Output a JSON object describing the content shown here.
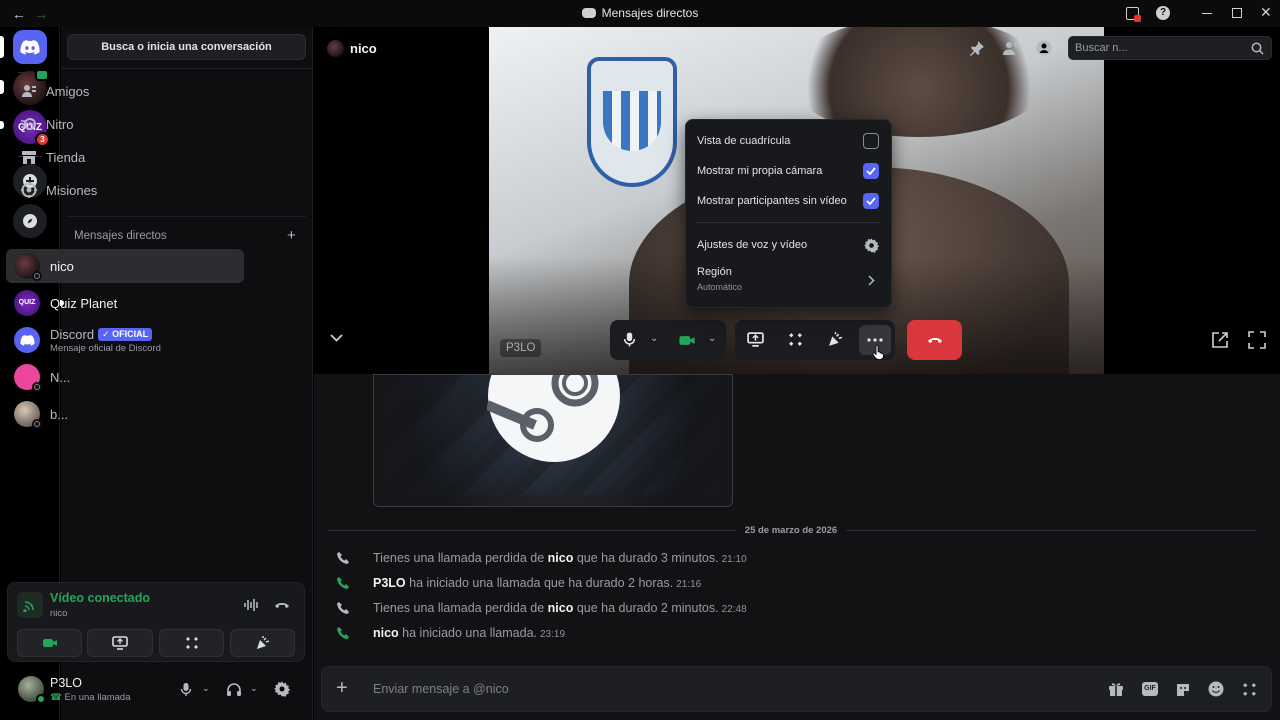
{
  "window": {
    "title": "Mensajes directos"
  },
  "sidebar": {
    "search_button": "Busca o inicia una conversación",
    "nav": [
      {
        "label": "Amigos",
        "icon": "friends-icon"
      },
      {
        "label": "Nitro",
        "icon": "nitro-icon"
      },
      {
        "label": "Tienda",
        "icon": "shop-icon"
      },
      {
        "label": "Misiones",
        "icon": "quests-icon"
      }
    ],
    "dm_header": "Mensajes directos",
    "dms": [
      {
        "name": "nico",
        "sub": ""
      },
      {
        "name": "Quiz Planet",
        "sub": ""
      },
      {
        "name": "Discord",
        "badge": "OFICIAL",
        "sub": "Mensaje oficial de Discord"
      },
      {
        "name": "N...",
        "sub": ""
      },
      {
        "name": "b...",
        "sub": ""
      }
    ]
  },
  "servers": {
    "quiz_badge": "3",
    "quiz_label": "QUIZ"
  },
  "voice_panel": {
    "status": "Vídeo conectado",
    "channel": "nico"
  },
  "user_panel": {
    "name": "P3LO",
    "status": "En una llamada"
  },
  "call": {
    "header_name": "nico",
    "search_placeholder": "Buscar n...",
    "self_label": "P3LO"
  },
  "menu": {
    "grid_view": "Vista de cuadrícula",
    "grid_view_checked": false,
    "show_camera": "Mostrar mi propia cámara",
    "show_camera_checked": true,
    "show_no_video": "Mostrar participantes sin vídeo",
    "show_no_video_checked": true,
    "voice_settings": "Ajustes de voz y vídeo",
    "region": "Región",
    "region_value": "Automático"
  },
  "chat": {
    "date_divider": "25 de marzo de 2026",
    "messages": [
      {
        "pre": "Tienes una llamada perdida de ",
        "who": "nico",
        "post": " que ha durado 3 minutos.",
        "time": "21:10",
        "missed": true
      },
      {
        "pre": "",
        "who": "P3LO",
        "post": " ha iniciado una llamada que ha durado 2 horas.",
        "time": "21:16",
        "missed": false
      },
      {
        "pre": "Tienes una llamada perdida de ",
        "who": "nico",
        "post": " que ha durado 2 minutos.",
        "time": "22:48",
        "missed": true
      },
      {
        "pre": "",
        "who": "nico",
        "post": " ha iniciado una llamada.",
        "time": "23:19",
        "missed": false
      }
    ],
    "input_placeholder": "Enviar mensaje a @nico"
  },
  "colors": {
    "blurple": "#5865f2",
    "green": "#23a55a",
    "red": "#da373c"
  }
}
